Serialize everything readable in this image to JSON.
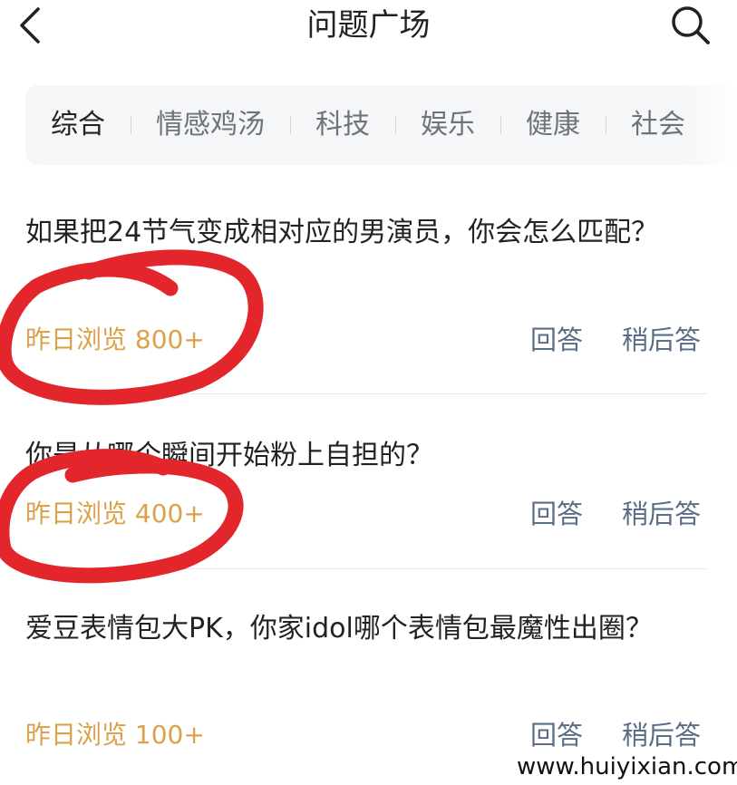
{
  "header": {
    "title": "问题广场",
    "back_icon": "chevron-left-icon",
    "search_icon": "search-icon"
  },
  "tabs": [
    {
      "label": "综合",
      "active": true
    },
    {
      "label": "情感鸡汤"
    },
    {
      "label": "科技"
    },
    {
      "label": "娱乐"
    },
    {
      "label": "健康"
    },
    {
      "label": "社会"
    }
  ],
  "questions": [
    {
      "title": "如果把24节气变成相对应的男演员，你会怎么匹配？",
      "views": "昨日浏览 800+",
      "answer_label": "回答",
      "later_label": "稍后答"
    },
    {
      "title": "你是从哪个瞬间开始粉上自担的？",
      "views": "昨日浏览 400+",
      "answer_label": "回答",
      "later_label": "稍后答"
    },
    {
      "title": "爱豆表情包大PK，你家idol哪个表情包最魔性出圈？",
      "views": "昨日浏览 100+",
      "answer_label": "回答",
      "later_label": "稍后答"
    }
  ],
  "colors": {
    "views": "#dba24a",
    "action": "#5a6d86",
    "annotation": "#e3262b"
  },
  "watermark": "www.huiyixian.com"
}
